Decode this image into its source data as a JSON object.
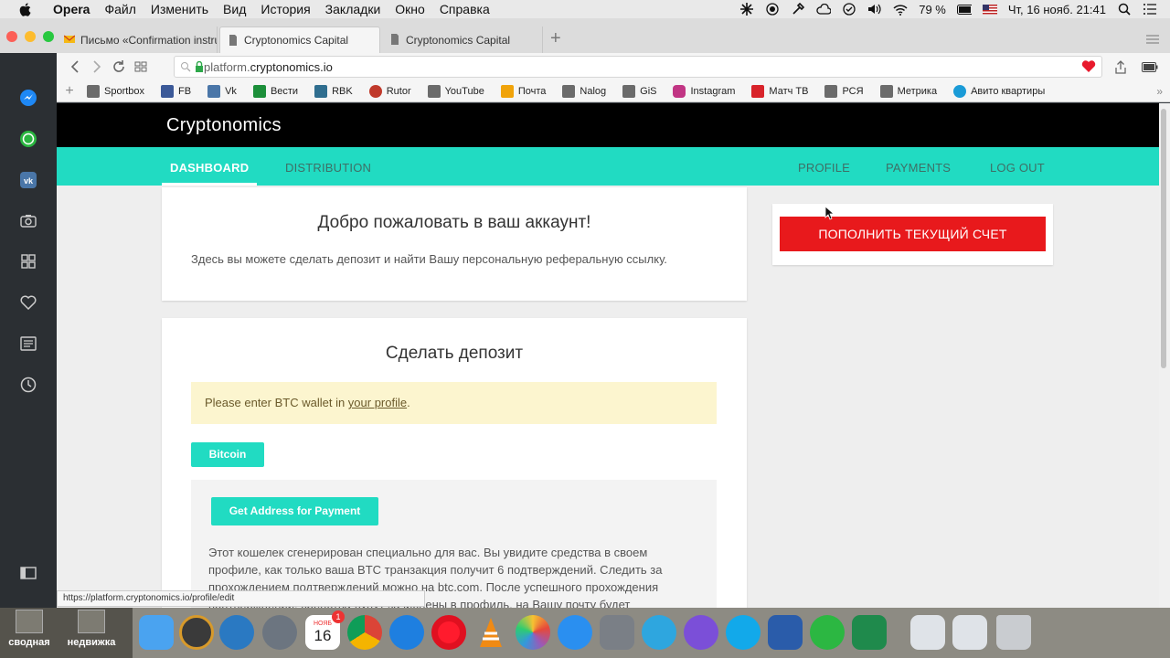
{
  "menubar": {
    "items": [
      "Opera",
      "Файл",
      "Изменить",
      "Вид",
      "История",
      "Закладки",
      "Окно",
      "Справка"
    ],
    "battery": "79 %",
    "datetime": "Чт, 16 нояб.  21:41"
  },
  "tabs": [
    {
      "label": "Письмо «Confirmation instru",
      "icon": "mail-icon",
      "active": false
    },
    {
      "label": "Cryptonomics Capital",
      "icon": "page-icon",
      "active": true
    },
    {
      "label": "Cryptonomics Capital",
      "icon": "page-icon",
      "active": false
    }
  ],
  "address": {
    "prefix": "platform.",
    "domain": "cryptonomics.io"
  },
  "bookmarks": [
    {
      "label": "Sportbox",
      "color": "#6b6b6b"
    },
    {
      "label": "FB",
      "color": "#3b5998"
    },
    {
      "label": "Vk",
      "color": "#4a76a8"
    },
    {
      "label": "Вести",
      "color": "#1c8f3a"
    },
    {
      "label": "RBK",
      "color": "#2f6e8f"
    },
    {
      "label": "Rutor",
      "color": "#c0392b"
    },
    {
      "label": "YouTube",
      "color": "#6b6b6b"
    },
    {
      "label": "Почта",
      "color": "#f0a30a"
    },
    {
      "label": "Nalog",
      "color": "#6b6b6b"
    },
    {
      "label": "GiS",
      "color": "#6b6b6b"
    },
    {
      "label": "Instagram",
      "color": "#c13584"
    },
    {
      "label": "Матч ТВ",
      "color": "#d8232a"
    },
    {
      "label": "РСЯ",
      "color": "#6b6b6b"
    },
    {
      "label": "Метрика",
      "color": "#6b6b6b"
    },
    {
      "label": "Авито квартиры",
      "color": "#1a9bd7"
    }
  ],
  "site": {
    "logo": "Cryptonomics",
    "nav_left": [
      "DASHBOARD",
      "DISTRIBUTION"
    ],
    "nav_right": [
      "PROFILE",
      "PAYMENTS",
      "LOG OUT"
    ],
    "welcome_title": "Добро пожаловать в ваш аккаунт!",
    "welcome_text": "Здесь вы можете сделать депозит и найти Вашу персональную реферальную ссылку.",
    "deposit_title": "Сделать депозит",
    "alert_prefix": "Please enter BTC wallet in ",
    "alert_link": "your profile",
    "alert_suffix": ".",
    "currency_tab": "Bitcoin",
    "get_address_button": "Get Address for Payment",
    "payment_text": "Этот кошелек сгенерирован специально для вас. Вы увидите средства в своем профиле, как только ваша BTC транзакция получит 6 подтверждений. Следить за прохождением подтверждений можно на btc.com. После успешного прохождения подтверждений, средства будут зачислены в профиль, на Вашу почту будет доставлено",
    "topup_button": "ПОПОЛНИТЬ ТЕКУЩИЙ СЧЕТ",
    "accent": "#21dbc2",
    "danger": "#e8191c"
  },
  "status_url": "https://platform.cryptonomics.io/profile/edit",
  "dock": {
    "desktops": [
      "сводная",
      "недвижка"
    ],
    "calendar_month": "НОЯБ",
    "calendar_day": "16",
    "calendar_badge": "1"
  }
}
